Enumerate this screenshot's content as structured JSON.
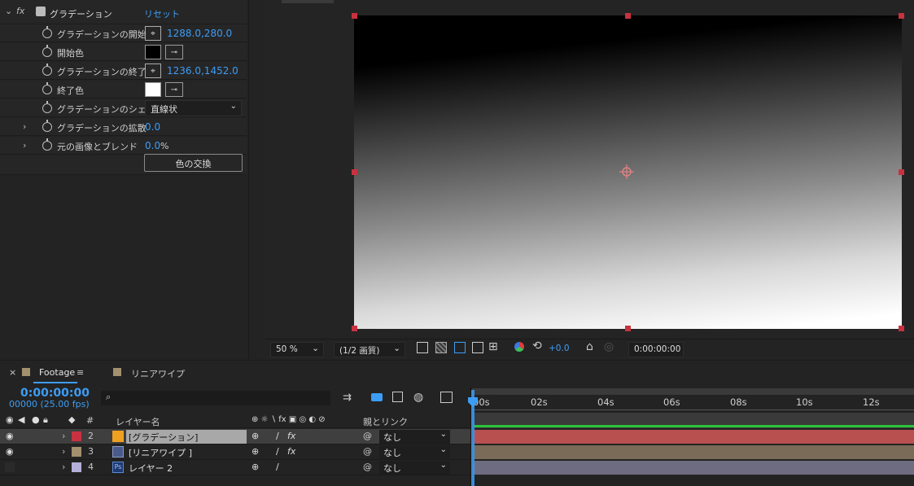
{
  "effects": {
    "fx_label": "fx",
    "effect_name": "グラデーション",
    "reset": "リセット",
    "props": [
      {
        "label": "グラデーションの開始",
        "value": "1288.0,280.0"
      },
      {
        "label": "開始色",
        "color": "#000000"
      },
      {
        "label": "グラデーションの終了",
        "value": "1236.0,1452.0"
      },
      {
        "label": "終了色",
        "color": "#ffffff"
      },
      {
        "label": "グラデーションのシェ",
        "value": "直線状"
      },
      {
        "label": "グラデーションの拡散",
        "value": "0.0"
      },
      {
        "label": "元の画像とブレンド",
        "value": "0.0",
        "unit": "%"
      }
    ],
    "swap_button": "色の交換"
  },
  "viewer": {
    "zoom": "50 %",
    "resolution": "(1/2 画質)",
    "exposure": "+0.0",
    "timecode": "0:00:00:00"
  },
  "timeline": {
    "tabs": [
      {
        "label": "Footage",
        "color": "#a3906f",
        "close": "×",
        "menu": "≡"
      },
      {
        "label": "リニアワイプ",
        "color": "#a3906f"
      }
    ],
    "current_time": "0:00:00:00",
    "frame_info": "00000 (25.00 fps)",
    "search_placeholder": "",
    "col_number": "#",
    "col_layer_name": "レイヤー名",
    "col_parent": "親とリンク",
    "switches": "⊕ ☼ ∖ fx ▣ ◎ ◐ ⊘",
    "ruler": [
      "00s",
      "02s",
      "04s",
      "06s",
      "08s",
      "10s",
      "12s"
    ],
    "layers": [
      {
        "num": "2",
        "name": "[グラデーション]",
        "label_color": "#c8313f",
        "icon_color": "#f0a020",
        "parent": "なし",
        "visible": true,
        "selected": true,
        "track_color": "#b85050"
      },
      {
        "num": "3",
        "name": "[リニアワイプ ]",
        "label_color": "#a3906f",
        "icon_color": "#6c7aa6",
        "parent": "なし",
        "visible": true,
        "selected": false,
        "track_color": "#7a6a58"
      },
      {
        "num": "4",
        "name": "レイヤー 2",
        "label_color": "#b4b0d8",
        "icon_color": "#1e3a70",
        "parent": "なし",
        "visible": false,
        "selected": false,
        "track_color": "#6e6c80"
      }
    ]
  }
}
